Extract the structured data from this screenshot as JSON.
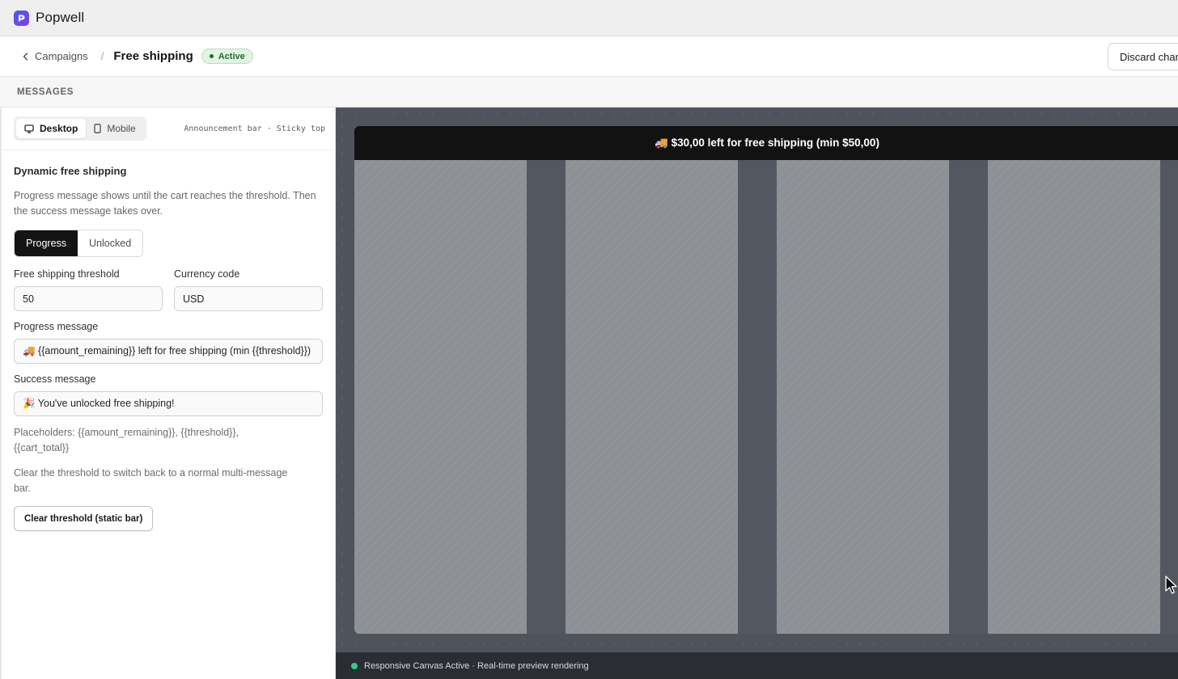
{
  "app": {
    "name": "Popwell",
    "logo_icon": "popwell-logo-icon"
  },
  "header": {
    "back_label": "Campaigns",
    "separator": "/",
    "title": "Free shipping",
    "status_badge": "Active",
    "discard_label": "Discard changes"
  },
  "section": {
    "label": "MESSAGES"
  },
  "device": {
    "options": [
      {
        "label": "Desktop",
        "icon": "monitor-icon",
        "selected": true
      },
      {
        "label": "Mobile",
        "icon": "smartphone-icon",
        "selected": false
      }
    ],
    "meta": "Announcement bar · Sticky top"
  },
  "free_shipping": {
    "title": "Dynamic free shipping",
    "description": "Progress message shows until the cart reaches the threshold. Then the success message takes over.",
    "mode_tabs": [
      {
        "label": "Progress",
        "selected": true
      },
      {
        "label": "Unlocked",
        "selected": false
      }
    ],
    "threshold_label": "Free shipping threshold",
    "threshold_value": "50",
    "currency_label": "Currency code",
    "currency_value": "USD",
    "progress_label": "Progress message",
    "progress_value": "🚚 {{amount_remaining}} left for free shipping (min {{threshold}})",
    "success_label": "Success message",
    "success_value": "🎉 You've unlocked free shipping!",
    "placeholders_hint": "Placeholders: {{amount_remaining}}, {{threshold}}, {{cart_total}}",
    "clear_hint": "Clear the threshold to switch back to a normal multi-message bar.",
    "clear_button": "Clear threshold (static bar)"
  },
  "preview": {
    "announcement_text": "🚚 $30,00 left for free shipping (min $50,00)",
    "status_text": "Responsive Canvas Active · Real-time preview rendering",
    "status_color": "#2ecc8a"
  }
}
